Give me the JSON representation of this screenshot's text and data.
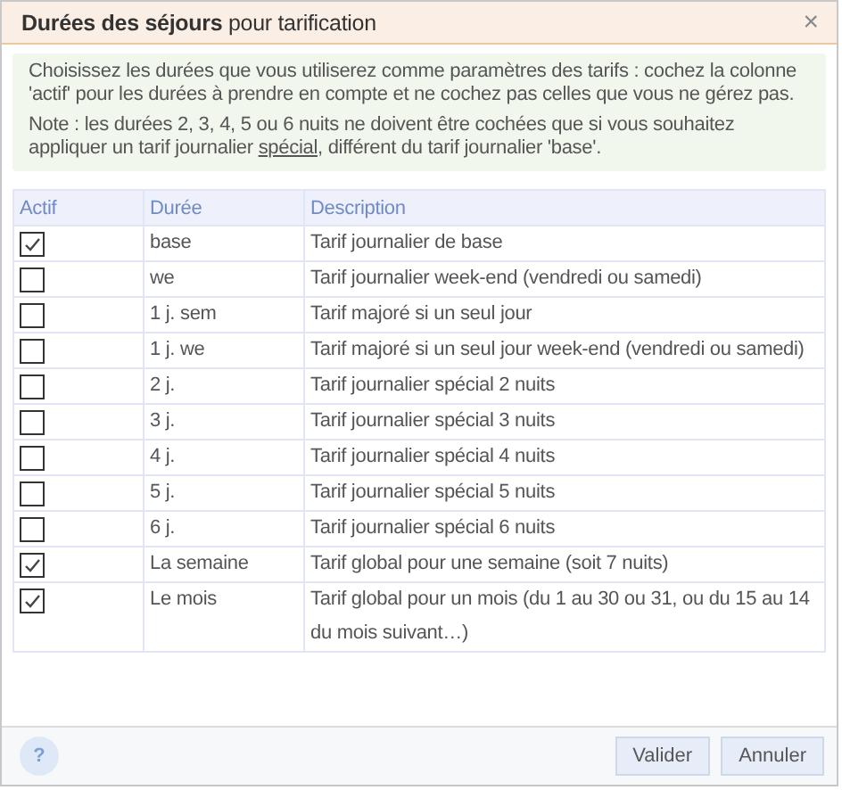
{
  "window": {
    "title": "**Durées des séjours** pour tarification",
    "close": "×"
  },
  "info": {
    "text": "Choisissez les durées que vous utiliserez comme paramètres des tarifs : cochez la colonne 'actif' pour les durées à prendre en compte et ne cochez pas celles que vous ne gérez pas.",
    "note_before": "Note : les durées 2, 3, 4, 5 ou 6 nuits ne doivent être cochées que si vous souhaitez appliquer un tarif journalier ",
    "note_underlined": "spécial",
    "note_after": ", différent du tarif journalier 'base'."
  },
  "table": {
    "columns": [
      "Actif",
      "Durée",
      "Description"
    ],
    "rows": [
      {
        "checked": true,
        "duration": "base",
        "description": "Tarif journalier de base"
      },
      {
        "checked": false,
        "duration": "we",
        "description": "Tarif journalier week-end (vendredi ou samedi)"
      },
      {
        "checked": false,
        "duration": "1 j. sem",
        "description": "Tarif majoré si un seul jour"
      },
      {
        "checked": false,
        "duration": "1 j. we",
        "description": "Tarif majoré si un seul jour week-end (vendredi ou samedi)"
      },
      {
        "checked": false,
        "duration": "2 j.",
        "description": "Tarif journalier spécial 2 nuits"
      },
      {
        "checked": false,
        "duration": "3 j.",
        "description": "Tarif journalier spécial 3 nuits"
      },
      {
        "checked": false,
        "duration": "4 j.",
        "description": "Tarif journalier spécial 4 nuits"
      },
      {
        "checked": false,
        "duration": "5 j.",
        "description": "Tarif journalier spécial 5 nuits"
      },
      {
        "checked": false,
        "duration": "6 j.",
        "description": "Tarif journalier spécial 6 nuits"
      },
      {
        "checked": true,
        "duration": "La semaine",
        "description": "Tarif global pour une semaine (soit 7 nuits)"
      },
      {
        "checked": true,
        "duration": "Le mois",
        "description": "Tarif global pour un mois (du 1 au 30 ou 31, ou du 15 au 14 du mois suivant…)"
      }
    ]
  },
  "footer": {
    "help": "?",
    "buttons": [
      "Valider",
      "Annuler"
    ]
  }
}
